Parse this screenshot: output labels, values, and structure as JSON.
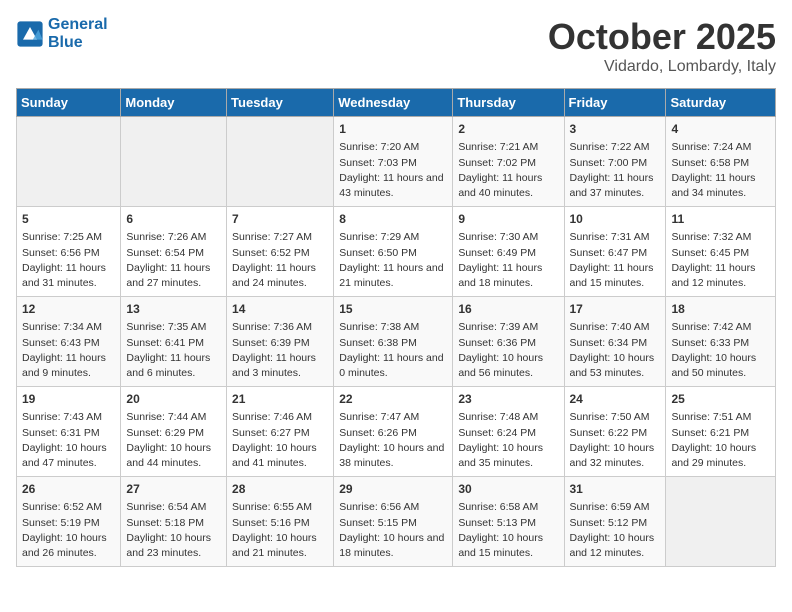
{
  "logo": {
    "line1": "General",
    "line2": "Blue"
  },
  "title": "October 2025",
  "location": "Vidardo, Lombardy, Italy",
  "days_of_week": [
    "Sunday",
    "Monday",
    "Tuesday",
    "Wednesday",
    "Thursday",
    "Friday",
    "Saturday"
  ],
  "weeks": [
    [
      {
        "day": "",
        "empty": true
      },
      {
        "day": "",
        "empty": true
      },
      {
        "day": "",
        "empty": true
      },
      {
        "day": "1",
        "sunrise": "Sunrise: 7:20 AM",
        "sunset": "Sunset: 7:03 PM",
        "daylight": "Daylight: 11 hours and 43 minutes."
      },
      {
        "day": "2",
        "sunrise": "Sunrise: 7:21 AM",
        "sunset": "Sunset: 7:02 PM",
        "daylight": "Daylight: 11 hours and 40 minutes."
      },
      {
        "day": "3",
        "sunrise": "Sunrise: 7:22 AM",
        "sunset": "Sunset: 7:00 PM",
        "daylight": "Daylight: 11 hours and 37 minutes."
      },
      {
        "day": "4",
        "sunrise": "Sunrise: 7:24 AM",
        "sunset": "Sunset: 6:58 PM",
        "daylight": "Daylight: 11 hours and 34 minutes."
      }
    ],
    [
      {
        "day": "5",
        "sunrise": "Sunrise: 7:25 AM",
        "sunset": "Sunset: 6:56 PM",
        "daylight": "Daylight: 11 hours and 31 minutes."
      },
      {
        "day": "6",
        "sunrise": "Sunrise: 7:26 AM",
        "sunset": "Sunset: 6:54 PM",
        "daylight": "Daylight: 11 hours and 27 minutes."
      },
      {
        "day": "7",
        "sunrise": "Sunrise: 7:27 AM",
        "sunset": "Sunset: 6:52 PM",
        "daylight": "Daylight: 11 hours and 24 minutes."
      },
      {
        "day": "8",
        "sunrise": "Sunrise: 7:29 AM",
        "sunset": "Sunset: 6:50 PM",
        "daylight": "Daylight: 11 hours and 21 minutes."
      },
      {
        "day": "9",
        "sunrise": "Sunrise: 7:30 AM",
        "sunset": "Sunset: 6:49 PM",
        "daylight": "Daylight: 11 hours and 18 minutes."
      },
      {
        "day": "10",
        "sunrise": "Sunrise: 7:31 AM",
        "sunset": "Sunset: 6:47 PM",
        "daylight": "Daylight: 11 hours and 15 minutes."
      },
      {
        "day": "11",
        "sunrise": "Sunrise: 7:32 AM",
        "sunset": "Sunset: 6:45 PM",
        "daylight": "Daylight: 11 hours and 12 minutes."
      }
    ],
    [
      {
        "day": "12",
        "sunrise": "Sunrise: 7:34 AM",
        "sunset": "Sunset: 6:43 PM",
        "daylight": "Daylight: 11 hours and 9 minutes."
      },
      {
        "day": "13",
        "sunrise": "Sunrise: 7:35 AM",
        "sunset": "Sunset: 6:41 PM",
        "daylight": "Daylight: 11 hours and 6 minutes."
      },
      {
        "day": "14",
        "sunrise": "Sunrise: 7:36 AM",
        "sunset": "Sunset: 6:39 PM",
        "daylight": "Daylight: 11 hours and 3 minutes."
      },
      {
        "day": "15",
        "sunrise": "Sunrise: 7:38 AM",
        "sunset": "Sunset: 6:38 PM",
        "daylight": "Daylight: 11 hours and 0 minutes."
      },
      {
        "day": "16",
        "sunrise": "Sunrise: 7:39 AM",
        "sunset": "Sunset: 6:36 PM",
        "daylight": "Daylight: 10 hours and 56 minutes."
      },
      {
        "day": "17",
        "sunrise": "Sunrise: 7:40 AM",
        "sunset": "Sunset: 6:34 PM",
        "daylight": "Daylight: 10 hours and 53 minutes."
      },
      {
        "day": "18",
        "sunrise": "Sunrise: 7:42 AM",
        "sunset": "Sunset: 6:33 PM",
        "daylight": "Daylight: 10 hours and 50 minutes."
      }
    ],
    [
      {
        "day": "19",
        "sunrise": "Sunrise: 7:43 AM",
        "sunset": "Sunset: 6:31 PM",
        "daylight": "Daylight: 10 hours and 47 minutes."
      },
      {
        "day": "20",
        "sunrise": "Sunrise: 7:44 AM",
        "sunset": "Sunset: 6:29 PM",
        "daylight": "Daylight: 10 hours and 44 minutes."
      },
      {
        "day": "21",
        "sunrise": "Sunrise: 7:46 AM",
        "sunset": "Sunset: 6:27 PM",
        "daylight": "Daylight: 10 hours and 41 minutes."
      },
      {
        "day": "22",
        "sunrise": "Sunrise: 7:47 AM",
        "sunset": "Sunset: 6:26 PM",
        "daylight": "Daylight: 10 hours and 38 minutes."
      },
      {
        "day": "23",
        "sunrise": "Sunrise: 7:48 AM",
        "sunset": "Sunset: 6:24 PM",
        "daylight": "Daylight: 10 hours and 35 minutes."
      },
      {
        "day": "24",
        "sunrise": "Sunrise: 7:50 AM",
        "sunset": "Sunset: 6:22 PM",
        "daylight": "Daylight: 10 hours and 32 minutes."
      },
      {
        "day": "25",
        "sunrise": "Sunrise: 7:51 AM",
        "sunset": "Sunset: 6:21 PM",
        "daylight": "Daylight: 10 hours and 29 minutes."
      }
    ],
    [
      {
        "day": "26",
        "sunrise": "Sunrise: 6:52 AM",
        "sunset": "Sunset: 5:19 PM",
        "daylight": "Daylight: 10 hours and 26 minutes."
      },
      {
        "day": "27",
        "sunrise": "Sunrise: 6:54 AM",
        "sunset": "Sunset: 5:18 PM",
        "daylight": "Daylight: 10 hours and 23 minutes."
      },
      {
        "day": "28",
        "sunrise": "Sunrise: 6:55 AM",
        "sunset": "Sunset: 5:16 PM",
        "daylight": "Daylight: 10 hours and 21 minutes."
      },
      {
        "day": "29",
        "sunrise": "Sunrise: 6:56 AM",
        "sunset": "Sunset: 5:15 PM",
        "daylight": "Daylight: 10 hours and 18 minutes."
      },
      {
        "day": "30",
        "sunrise": "Sunrise: 6:58 AM",
        "sunset": "Sunset: 5:13 PM",
        "daylight": "Daylight: 10 hours and 15 minutes."
      },
      {
        "day": "31",
        "sunrise": "Sunrise: 6:59 AM",
        "sunset": "Sunset: 5:12 PM",
        "daylight": "Daylight: 10 hours and 12 minutes."
      },
      {
        "day": "",
        "empty": true
      }
    ]
  ]
}
